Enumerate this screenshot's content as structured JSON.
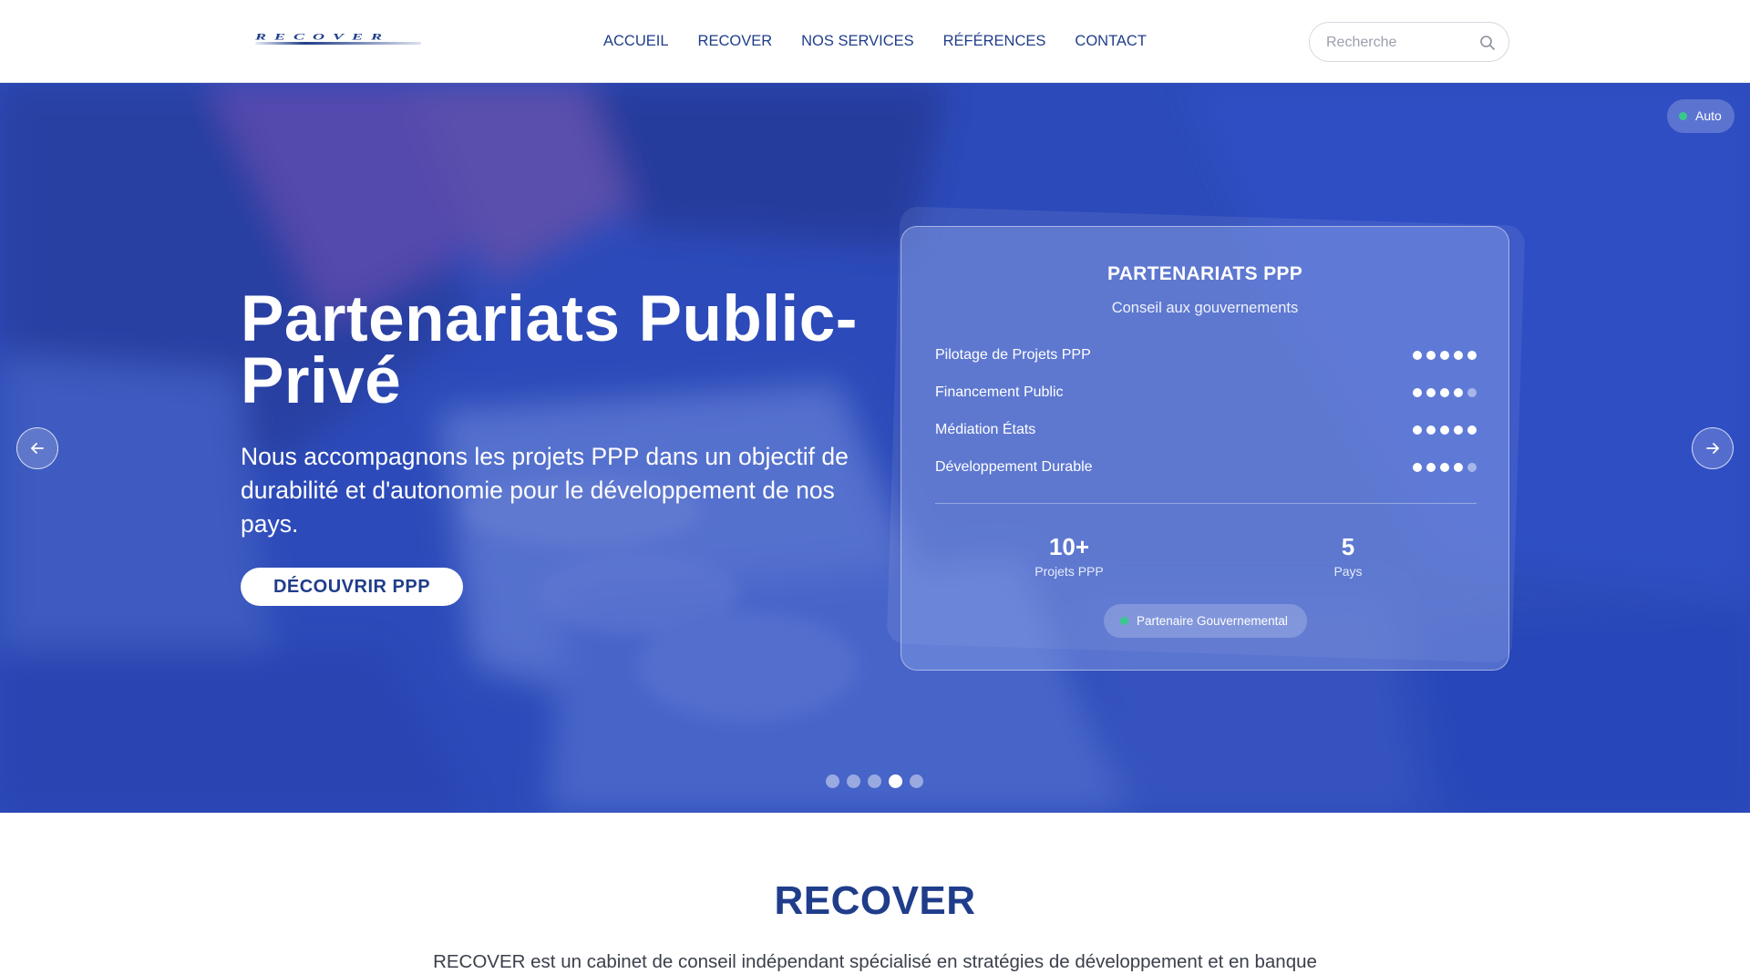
{
  "header": {
    "logo_text": "RECOVER",
    "nav": [
      "ACCUEIL",
      "RECOVER",
      "NOS SERVICES",
      "RÉFÉRENCES",
      "CONTACT"
    ],
    "search_placeholder": "Recherche"
  },
  "hero": {
    "auto_label": "Auto",
    "title": "Partenariats Public-Privé",
    "description": "Nous accompagnons les projets PPP dans un objectif de durabilité et d'autonomie pour le développement de nos pays.",
    "cta_label": "DÉCOUVRIR PPP",
    "slides_count": 5,
    "active_slide": 4
  },
  "card": {
    "title": "PARTENARIATS PPP",
    "subtitle": "Conseil aux gouvernements",
    "skills": [
      {
        "label": "Pilotage de Projets PPP",
        "rating": 5,
        "max": 5
      },
      {
        "label": "Financement Public",
        "rating": 4,
        "max": 5
      },
      {
        "label": "Médiation États",
        "rating": 5,
        "max": 5
      },
      {
        "label": "Développement Durable",
        "rating": 4,
        "max": 5
      }
    ],
    "stats": [
      {
        "value": "10+",
        "label": "Projets PPP"
      },
      {
        "value": "5",
        "label": "Pays"
      }
    ],
    "badge": "Partenaire Gouvernemental"
  },
  "about": {
    "title": "RECOVER",
    "text": "RECOVER est un cabinet de conseil indépendant spécialisé en stratégies de développement et en banque"
  },
  "colors": {
    "brand": "#1f3d8a",
    "hero_overlay": "#2b48b3",
    "status_green": "#38c98a"
  }
}
